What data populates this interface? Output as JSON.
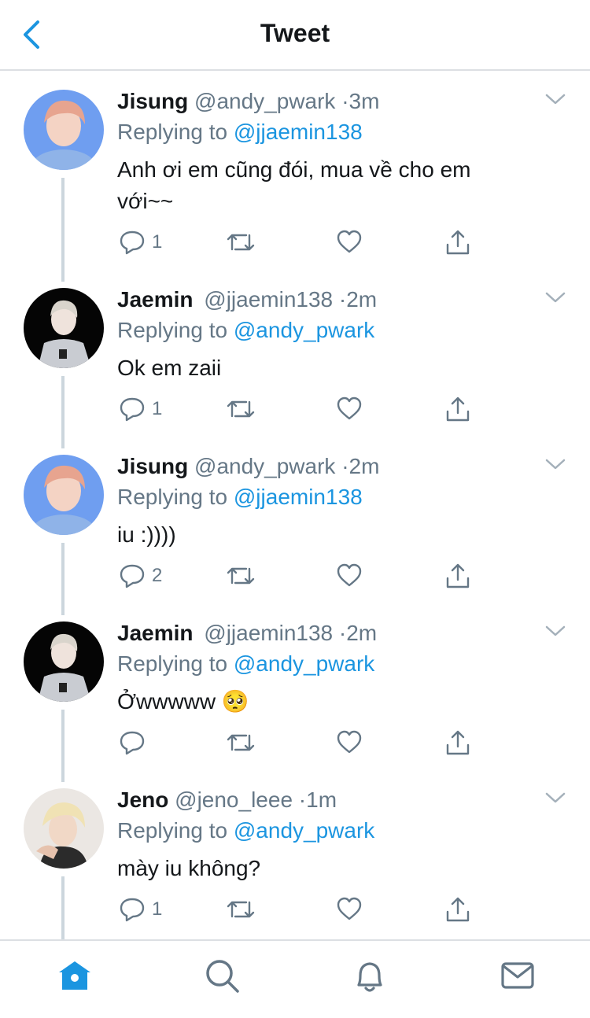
{
  "header": {
    "title": "Tweet",
    "back_icon": "chevron-left-icon",
    "accent_color": "#1b95e0"
  },
  "tweets": [
    {
      "name": "Jisung",
      "handle": "@andy_pwark",
      "dot": "·",
      "time": "3m",
      "replying_prefix": "Replying to",
      "replying_to": "@jjaemin138",
      "text_line1": "Anh ơi em cũng đói, mua về cho em",
      "text_line2": "với~~",
      "reply_count": "1",
      "avatar": "jisung-avatar"
    },
    {
      "name": "Jaemin",
      "handle": "@jjaemin138",
      "dot": "·",
      "time": "2m",
      "replying_prefix": "Replying to",
      "replying_to": "@andy_pwark",
      "text_line1": "Ok em zaii",
      "reply_count": "1",
      "avatar": "jaemin-avatar"
    },
    {
      "name": "Jisung",
      "handle": "@andy_pwark",
      "dot": "·",
      "time": "2m",
      "replying_prefix": "Replying to",
      "replying_to": "@jjaemin138",
      "text_line1": "iu :))))",
      "reply_count": "2",
      "avatar": "jisung-avatar"
    },
    {
      "name": "Jaemin",
      "handle": "@jjaemin138",
      "dot": "·",
      "time": "2m",
      "replying_prefix": "Replying to",
      "replying_to": "@andy_pwark",
      "text_line1": "Ởwwwww 🥺",
      "reply_count": "",
      "avatar": "jaemin-avatar"
    },
    {
      "name": "Jeno",
      "handle": "@jeno_leee",
      "dot": "·",
      "time": "1m",
      "replying_prefix": "Replying to",
      "replying_to": "@andy_pwark",
      "text_line1": "mày iu không?",
      "reply_count": "1",
      "avatar": "jeno-avatar"
    }
  ],
  "tabbar": {
    "items": [
      "home-icon",
      "search-icon",
      "bell-icon",
      "mail-icon"
    ],
    "active": "home-icon"
  },
  "colors": {
    "text": "#14171a",
    "secondary": "#657786",
    "link": "#1b95e0",
    "divider": "#dcdfe3"
  }
}
